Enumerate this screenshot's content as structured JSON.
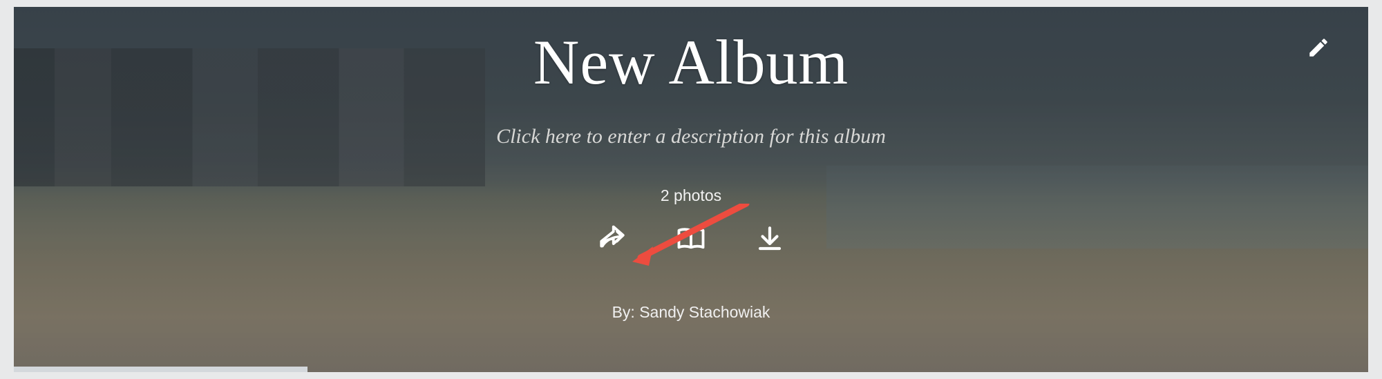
{
  "album": {
    "title": "New Album",
    "description_placeholder": "Click here to enter a description for this album",
    "photo_count": "2 photos",
    "byline_prefix": "By: ",
    "author": "Sandy Stachowiak"
  },
  "actions": {
    "share": "share",
    "book": "book",
    "download": "download"
  },
  "edit": {
    "label": "Edit"
  },
  "annotation": {
    "arrow_color": "#ed4c3f"
  }
}
